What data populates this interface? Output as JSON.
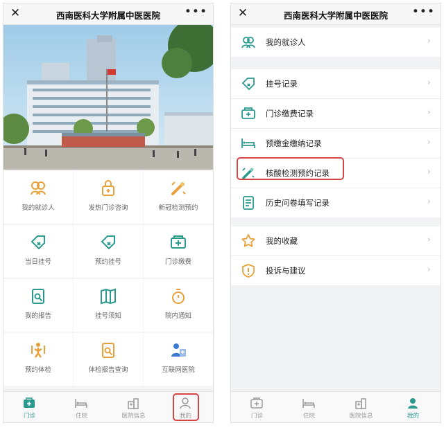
{
  "left": {
    "nav": {
      "title": "西南医科大学附属中医医院",
      "close_glyph": "✕",
      "more_glyph": "•••"
    },
    "grid": [
      {
        "label": "我的就诊人",
        "icon": "patients-icon"
      },
      {
        "label": "发热门诊咨询",
        "icon": "fever-clinic-icon"
      },
      {
        "label": "新冠检测预约",
        "icon": "covid-test-icon"
      },
      {
        "label": "当日挂号",
        "icon": "same-day-register-icon"
      },
      {
        "label": "预约挂号",
        "icon": "appointment-register-icon"
      },
      {
        "label": "门诊缴费",
        "icon": "outpatient-payment-icon"
      },
      {
        "label": "我的报告",
        "icon": "report-icon"
      },
      {
        "label": "挂号须知",
        "icon": "register-guide-icon"
      },
      {
        "label": "院内通知",
        "icon": "hospital-notice-icon"
      },
      {
        "label": "预约体检",
        "icon": "checkup-appointment-icon"
      },
      {
        "label": "体检报告查询",
        "icon": "checkup-report-icon"
      },
      {
        "label": "互联网医院",
        "icon": "internet-hospital-icon"
      }
    ],
    "tabs": [
      {
        "label": "门诊",
        "icon": "outpatient-tab-icon",
        "active": true
      },
      {
        "label": "住院",
        "icon": "inpatient-tab-icon",
        "active": false
      },
      {
        "label": "医院信息",
        "icon": "hospital-info-tab-icon",
        "active": false
      },
      {
        "label": "我的",
        "icon": "mine-tab-icon",
        "active": false
      }
    ]
  },
  "right": {
    "nav": {
      "title": "西南医科大学附属中医医院",
      "close_glyph": "✕",
      "more_glyph": "•••"
    },
    "group1": [
      {
        "label": "我的就诊人",
        "icon": "patients-icon"
      }
    ],
    "group2": [
      {
        "label": "挂号记录",
        "icon": "register-record-icon"
      },
      {
        "label": "门诊缴费记录",
        "icon": "payment-record-icon"
      },
      {
        "label": "预缴金缴纳记录",
        "icon": "prepayment-record-icon"
      },
      {
        "label": "核酸检测预约记录",
        "icon": "nucleic-test-record-icon",
        "highlighted": true
      },
      {
        "label": "历史问卷填写记录",
        "icon": "questionnaire-record-icon"
      }
    ],
    "group3": [
      {
        "label": "我的收藏",
        "icon": "star-icon"
      },
      {
        "label": "投诉与建议",
        "icon": "complaint-icon"
      }
    ],
    "chevron": "›",
    "tabs": [
      {
        "label": "门诊",
        "icon": "outpatient-tab-icon",
        "active": false
      },
      {
        "label": "住院",
        "icon": "inpatient-tab-icon",
        "active": false
      },
      {
        "label": "医院信息",
        "icon": "hospital-info-tab-icon",
        "active": false
      },
      {
        "label": "我的",
        "icon": "mine-tab-icon",
        "active": true
      }
    ]
  },
  "colors": {
    "accent": "#2a9a8f",
    "orange": "#e8a13a",
    "highlight": "#d64545"
  }
}
